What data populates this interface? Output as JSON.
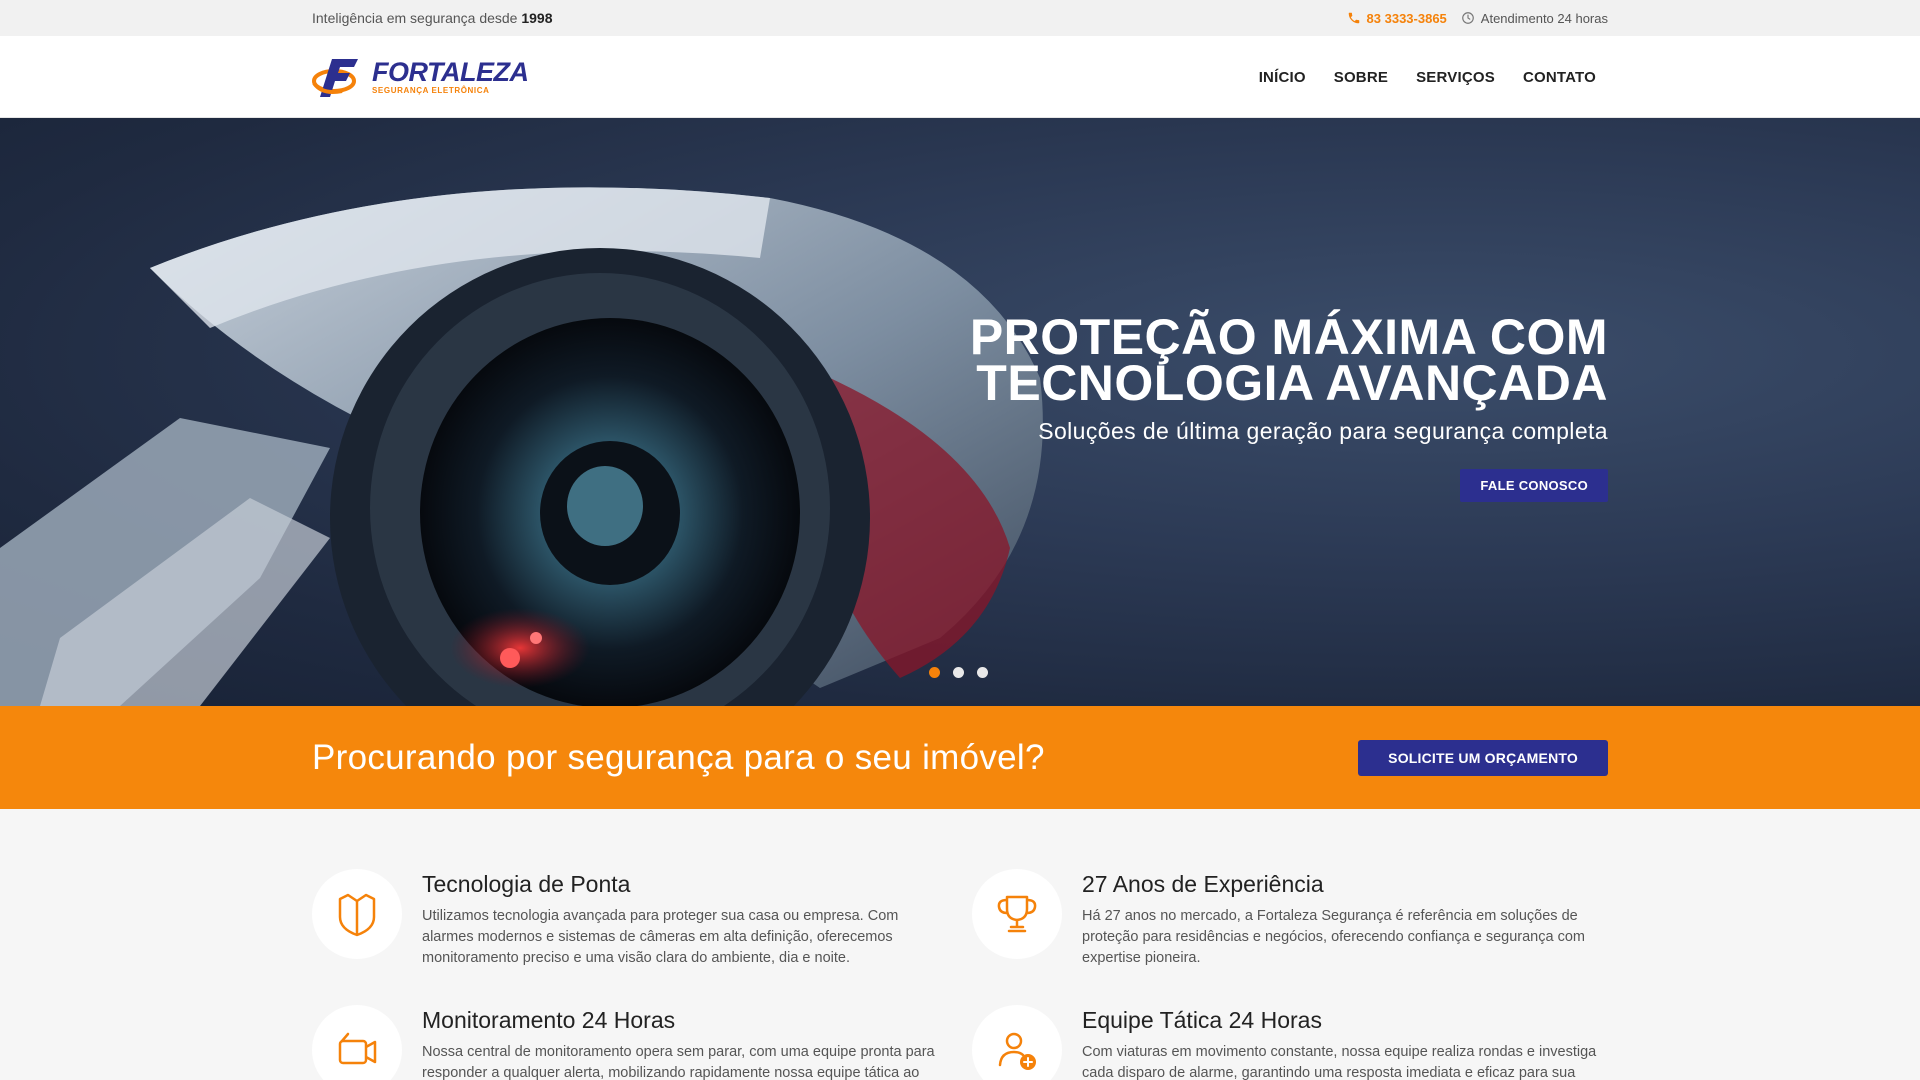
{
  "topbar": {
    "tagline_prefix": "Inteligência em segurança desde",
    "tagline_year": "1998",
    "phone": "83 3333-3865",
    "hours": "Atendimento 24 horas"
  },
  "brand": {
    "name": "FORTALEZA",
    "subtitle": "SEGURANÇA ELETRÔNICA",
    "primary_color": "#2c2f8f",
    "accent_color": "#f5820a"
  },
  "nav": {
    "items": [
      {
        "label": "INÍCIO"
      },
      {
        "label": "SOBRE"
      },
      {
        "label": "SERVIÇOS"
      },
      {
        "label": "CONTATO"
      }
    ]
  },
  "hero": {
    "title_line1": "PROTEÇÃO MÁXIMA COM",
    "title_line2": "TECNOLOGIA AVANÇADA",
    "subtitle": "Soluções de última geração para segurança completa",
    "button": "FALE CONOSCO",
    "slides": 3,
    "active_slide": 1
  },
  "cta": {
    "text": "Procurando por segurança para o seu imóvel?",
    "button": "SOLICITE UM ORÇAMENTO"
  },
  "features": [
    {
      "icon": "shield-icon",
      "title": "Tecnologia de Ponta",
      "desc": "Utilizamos tecnologia avançada para proteger sua casa ou empresa. Com alarmes modernos e sistemas de câmeras em alta definição, oferecemos monitoramento preciso e uma visão clara do ambiente, dia e noite."
    },
    {
      "icon": "trophy-icon",
      "title": "27 Anos de Experiência",
      "desc": "Há 27 anos no mercado, a Fortaleza Segurança é referência em soluções de proteção para residências e negócios, oferecendo confiança e segurança com expertise pioneira."
    },
    {
      "icon": "video-camera-icon",
      "title": "Monitoramento 24 Horas",
      "desc": "Nossa central de monitoramento opera sem parar, com uma equipe pronta para responder a qualquer alerta, mobilizando rapidamente nossa equipe tática ao local."
    },
    {
      "icon": "user-add-icon",
      "title": "Equipe Tática 24 Horas",
      "desc": "Com viaturas em movimento constante, nossa equipe realiza rondas e investiga cada disparo de alarme, garantindo uma resposta imediata e eficaz para sua segurança."
    }
  ]
}
